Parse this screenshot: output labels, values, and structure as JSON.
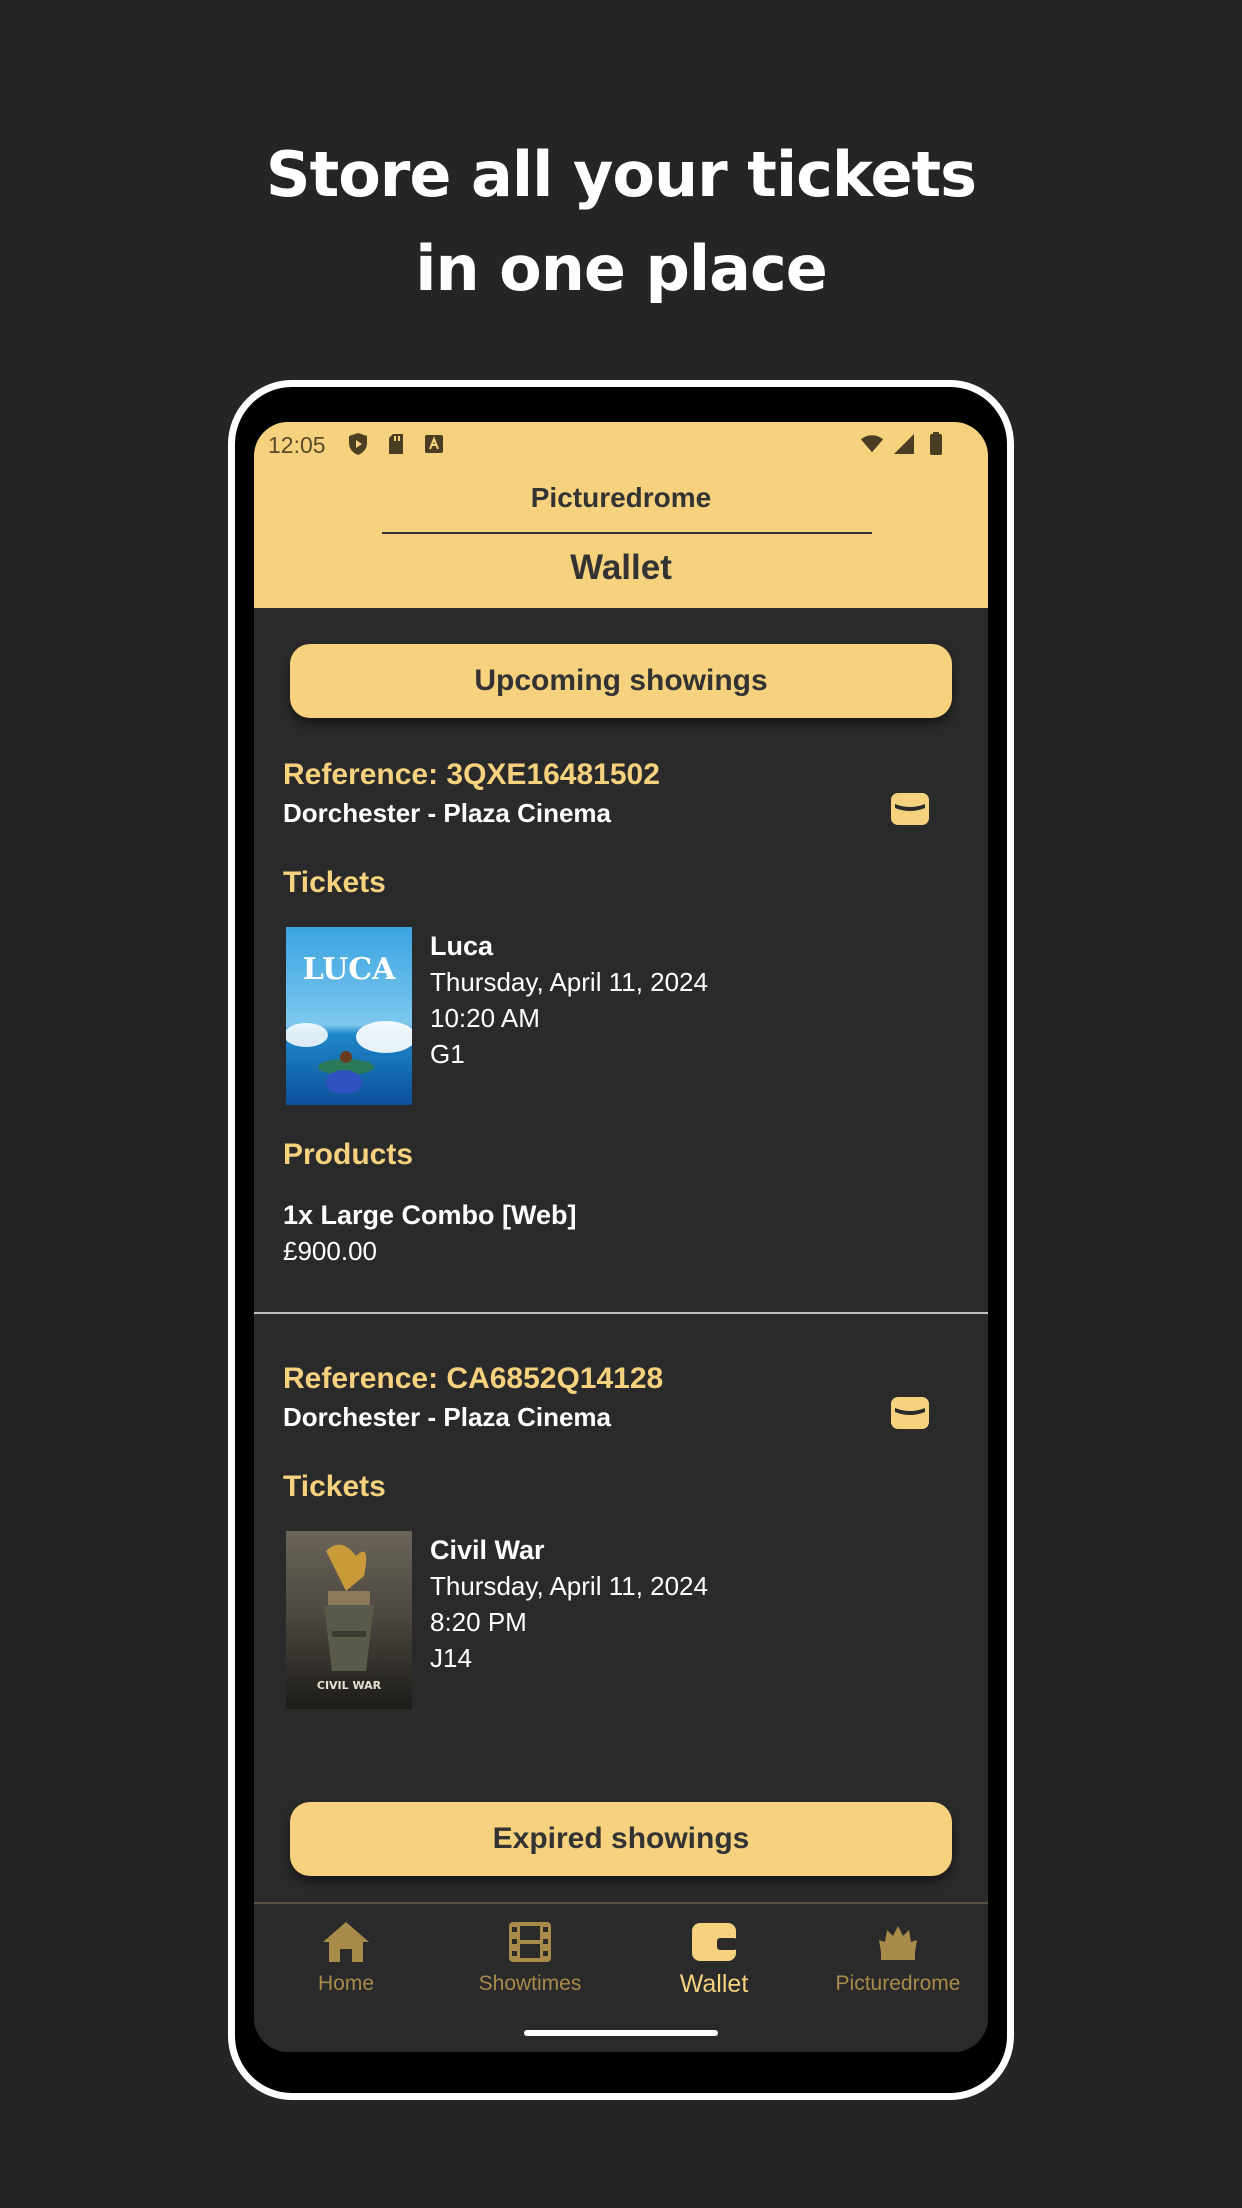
{
  "promo": {
    "headline_line1": "Store all your tickets",
    "headline_line2": "in one place"
  },
  "status_bar": {
    "time": "12:05",
    "left_icons": [
      "play-protect-icon",
      "sd-card-icon",
      "font-a-icon"
    ],
    "right_icons": [
      "wifi-icon",
      "signal-icon",
      "battery-icon"
    ]
  },
  "app_bar": {
    "cinema_name": "Picturedrome",
    "title": "Wallet"
  },
  "wallet": {
    "upcoming_button": "Upcoming showings",
    "expired_button": "Expired showings",
    "bookings": [
      {
        "reference": "Reference: 3QXE16481502",
        "location": "Dorchester - Plaza Cinema",
        "tickets_heading": "Tickets",
        "tickets": [
          {
            "poster_alt": "Luca",
            "title": "Luca",
            "date": "Thursday, April 11, 2024",
            "time": "10:20 AM",
            "seat": "G1"
          }
        ],
        "products_heading": "Products",
        "products": [
          {
            "name": "1x Large Combo [Web]",
            "price": "£900.00"
          }
        ]
      },
      {
        "reference": "Reference: CA6852Q14128",
        "location": "Dorchester - Plaza Cinema",
        "tickets_heading": "Tickets",
        "tickets": [
          {
            "poster_alt": "Civil War",
            "title": "Civil War",
            "date": "Thursday, April 11, 2024",
            "time": "8:20 PM",
            "seat": "J14"
          }
        ]
      }
    ]
  },
  "bottom_nav": {
    "items": [
      {
        "label": "Home",
        "icon": "home-icon",
        "active": false
      },
      {
        "label": "Showtimes",
        "icon": "film-icon",
        "active": false
      },
      {
        "label": "Wallet",
        "icon": "wallet-icon",
        "active": true
      },
      {
        "label": "Picturedrome",
        "icon": "cinema-logo-icon",
        "active": false
      }
    ]
  },
  "colors": {
    "accent": "#f6d27f",
    "background": "#2a2a2a",
    "page_background": "#252525",
    "nav_inactive": "#a88a4a"
  },
  "poster_labels": {
    "luca": "LUCA",
    "civil_war": "CIVIL WAR"
  }
}
